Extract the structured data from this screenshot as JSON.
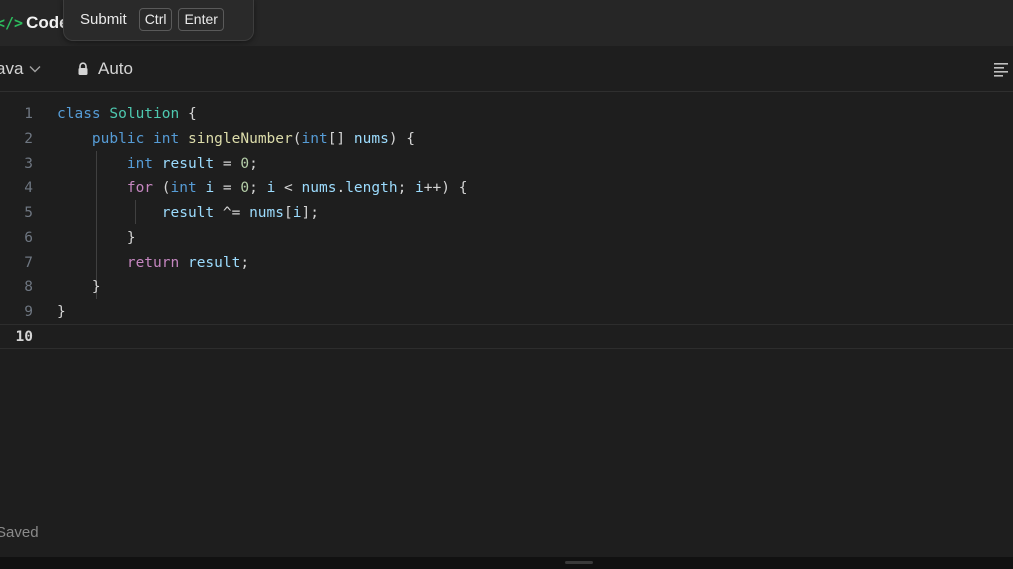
{
  "header": {
    "brand_icon": "</>",
    "brand_label": "Code",
    "tooltip": {
      "label": "Submit",
      "keys": [
        "Ctrl",
        "Enter"
      ]
    }
  },
  "toolbar": {
    "language": "Java",
    "language_visible": "ava",
    "mode": "Auto",
    "icons": [
      "chevron-down-icon",
      "lock-icon",
      "format-menu-icon"
    ]
  },
  "editor": {
    "current_line": 10,
    "line_numbers": [
      "1",
      "2",
      "3",
      "4",
      "5",
      "6",
      "7",
      "8",
      "9",
      "10"
    ],
    "lines": [
      "class Solution {",
      "    public int singleNumber(int[] nums) {",
      "        int result = 0;",
      "        for (int i = 0; i < nums.length; i++) {",
      "            result ^= nums[i];",
      "        }",
      "        return result;",
      "    }",
      "}",
      ""
    ]
  },
  "status": {
    "saved_visible": "Saved"
  },
  "colors": {
    "background": "#1e1e1e",
    "header": "#262626",
    "brand_accent": "#2cbb5d",
    "keyword": "#569cd6",
    "type": "#4ec9b0",
    "function": "#dcdcaa",
    "variable": "#9cdcfe",
    "number": "#b5cea8",
    "control": "#c586c0"
  }
}
